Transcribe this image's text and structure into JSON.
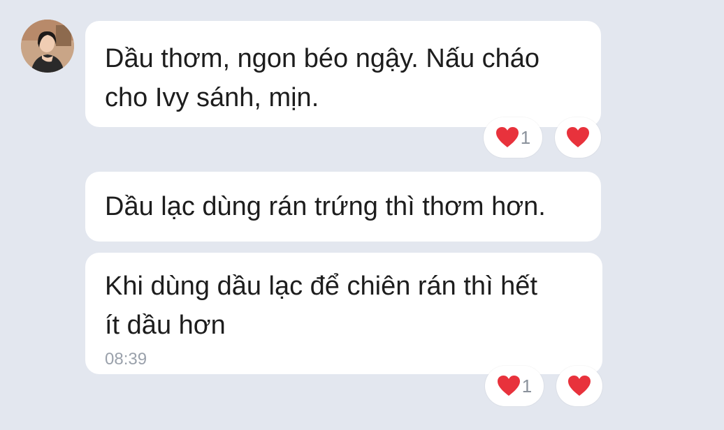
{
  "messages": [
    {
      "text": "Dầu thơm, ngon béo ngậy. Nấu cháo\ncho Ivy sánh, mịn."
    },
    {
      "text": "Dầu lạc dùng rán trứng thì thơm hơn."
    },
    {
      "text": "Khi dùng dầu lạc để chiên rán thì hết\nít dầu hơn",
      "time": "08:39"
    }
  ],
  "reactions": [
    {
      "icon": "heart-icon",
      "count": "1"
    },
    {
      "icon": "heart-icon"
    },
    {
      "icon": "heart-icon",
      "count": "1"
    },
    {
      "icon": "heart-icon"
    }
  ],
  "colors": {
    "background": "#e3e7ef",
    "bubble": "#ffffff",
    "heart": "#e8323c",
    "time": "#9aa1ab"
  }
}
